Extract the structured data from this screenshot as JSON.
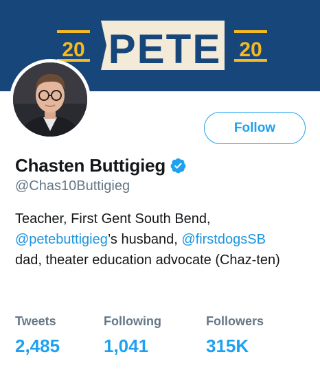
{
  "banner": {
    "text": "PETE",
    "year_left": "20",
    "year_right": "20",
    "colors": {
      "navy": "#17467a",
      "cream": "#f3ead8",
      "gold": "#f5b924"
    }
  },
  "profile": {
    "name": "Chasten Buttigieg",
    "handle": "@Chas10Buttigieg",
    "verified_icon": "verified-badge-icon",
    "follow_label": "Follow"
  },
  "bio": {
    "line1": "Teacher, First Gent South Bend,",
    "mention1": "@petebuttigieg",
    "text2": "’s husband, ",
    "mention2": "@firstdogsSB",
    "text3": "dad, theater education advocate (Chaz-ten)"
  },
  "stats": [
    {
      "label": "Tweets",
      "value": "2,485"
    },
    {
      "label": "Following",
      "value": "1,041"
    },
    {
      "label": "Followers",
      "value": "315K"
    }
  ],
  "colors": {
    "accent": "#1da1f2",
    "link": "#1b95e0",
    "muted": "#657786",
    "text": "#14171a"
  }
}
